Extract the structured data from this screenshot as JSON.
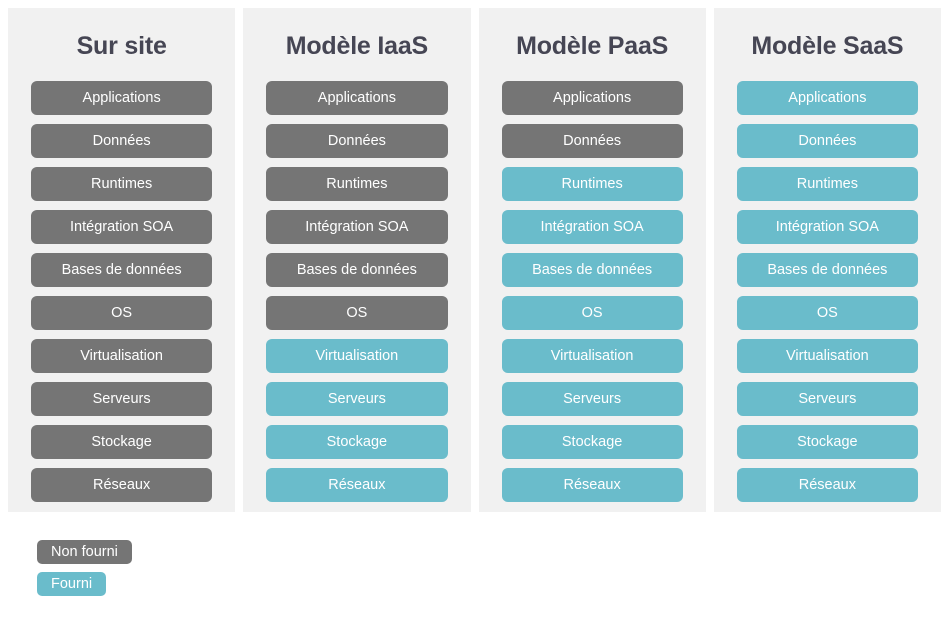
{
  "colors": {
    "provided": "#6abccb",
    "not_provided": "#757575",
    "panel_background": "#f1f1f1",
    "page_background": "#ffffff",
    "title_text": "#464654",
    "pill_text": "#ffffff"
  },
  "columns": [
    {
      "title": "Sur site",
      "layers": [
        {
          "label": "Applications",
          "state": "not_provided"
        },
        {
          "label": "Données",
          "state": "not_provided"
        },
        {
          "label": "Runtimes",
          "state": "not_provided"
        },
        {
          "label": "Intégration SOA",
          "state": "not_provided"
        },
        {
          "label": "Bases de données",
          "state": "not_provided"
        },
        {
          "label": "OS",
          "state": "not_provided"
        },
        {
          "label": "Virtualisation",
          "state": "not_provided"
        },
        {
          "label": "Serveurs",
          "state": "not_provided"
        },
        {
          "label": "Stockage",
          "state": "not_provided"
        },
        {
          "label": "Réseaux",
          "state": "not_provided"
        }
      ]
    },
    {
      "title": "Modèle IaaS",
      "layers": [
        {
          "label": "Applications",
          "state": "not_provided"
        },
        {
          "label": "Données",
          "state": "not_provided"
        },
        {
          "label": "Runtimes",
          "state": "not_provided"
        },
        {
          "label": "Intégration SOA",
          "state": "not_provided"
        },
        {
          "label": "Bases de données",
          "state": "not_provided"
        },
        {
          "label": "OS",
          "state": "not_provided"
        },
        {
          "label": "Virtualisation",
          "state": "provided"
        },
        {
          "label": "Serveurs",
          "state": "provided"
        },
        {
          "label": "Stockage",
          "state": "provided"
        },
        {
          "label": "Réseaux",
          "state": "provided"
        }
      ]
    },
    {
      "title": "Modèle PaaS",
      "layers": [
        {
          "label": "Applications",
          "state": "not_provided"
        },
        {
          "label": "Données",
          "state": "not_provided"
        },
        {
          "label": "Runtimes",
          "state": "provided"
        },
        {
          "label": "Intégration SOA",
          "state": "provided"
        },
        {
          "label": "Bases de données",
          "state": "provided"
        },
        {
          "label": "OS",
          "state": "provided"
        },
        {
          "label": "Virtualisation",
          "state": "provided"
        },
        {
          "label": "Serveurs",
          "state": "provided"
        },
        {
          "label": "Stockage",
          "state": "provided"
        },
        {
          "label": "Réseaux",
          "state": "provided"
        }
      ]
    },
    {
      "title": "Modèle SaaS",
      "layers": [
        {
          "label": "Applications",
          "state": "provided"
        },
        {
          "label": "Données",
          "state": "provided"
        },
        {
          "label": "Runtimes",
          "state": "provided"
        },
        {
          "label": "Intégration SOA",
          "state": "provided"
        },
        {
          "label": "Bases de données",
          "state": "provided"
        },
        {
          "label": "OS",
          "state": "provided"
        },
        {
          "label": "Virtualisation",
          "state": "provided"
        },
        {
          "label": "Serveurs",
          "state": "provided"
        },
        {
          "label": "Stockage",
          "state": "provided"
        },
        {
          "label": "Réseaux",
          "state": "provided"
        }
      ]
    }
  ],
  "legend": [
    {
      "label": "Non fourni",
      "state": "not_provided"
    },
    {
      "label": "Fourni",
      "state": "provided"
    }
  ]
}
